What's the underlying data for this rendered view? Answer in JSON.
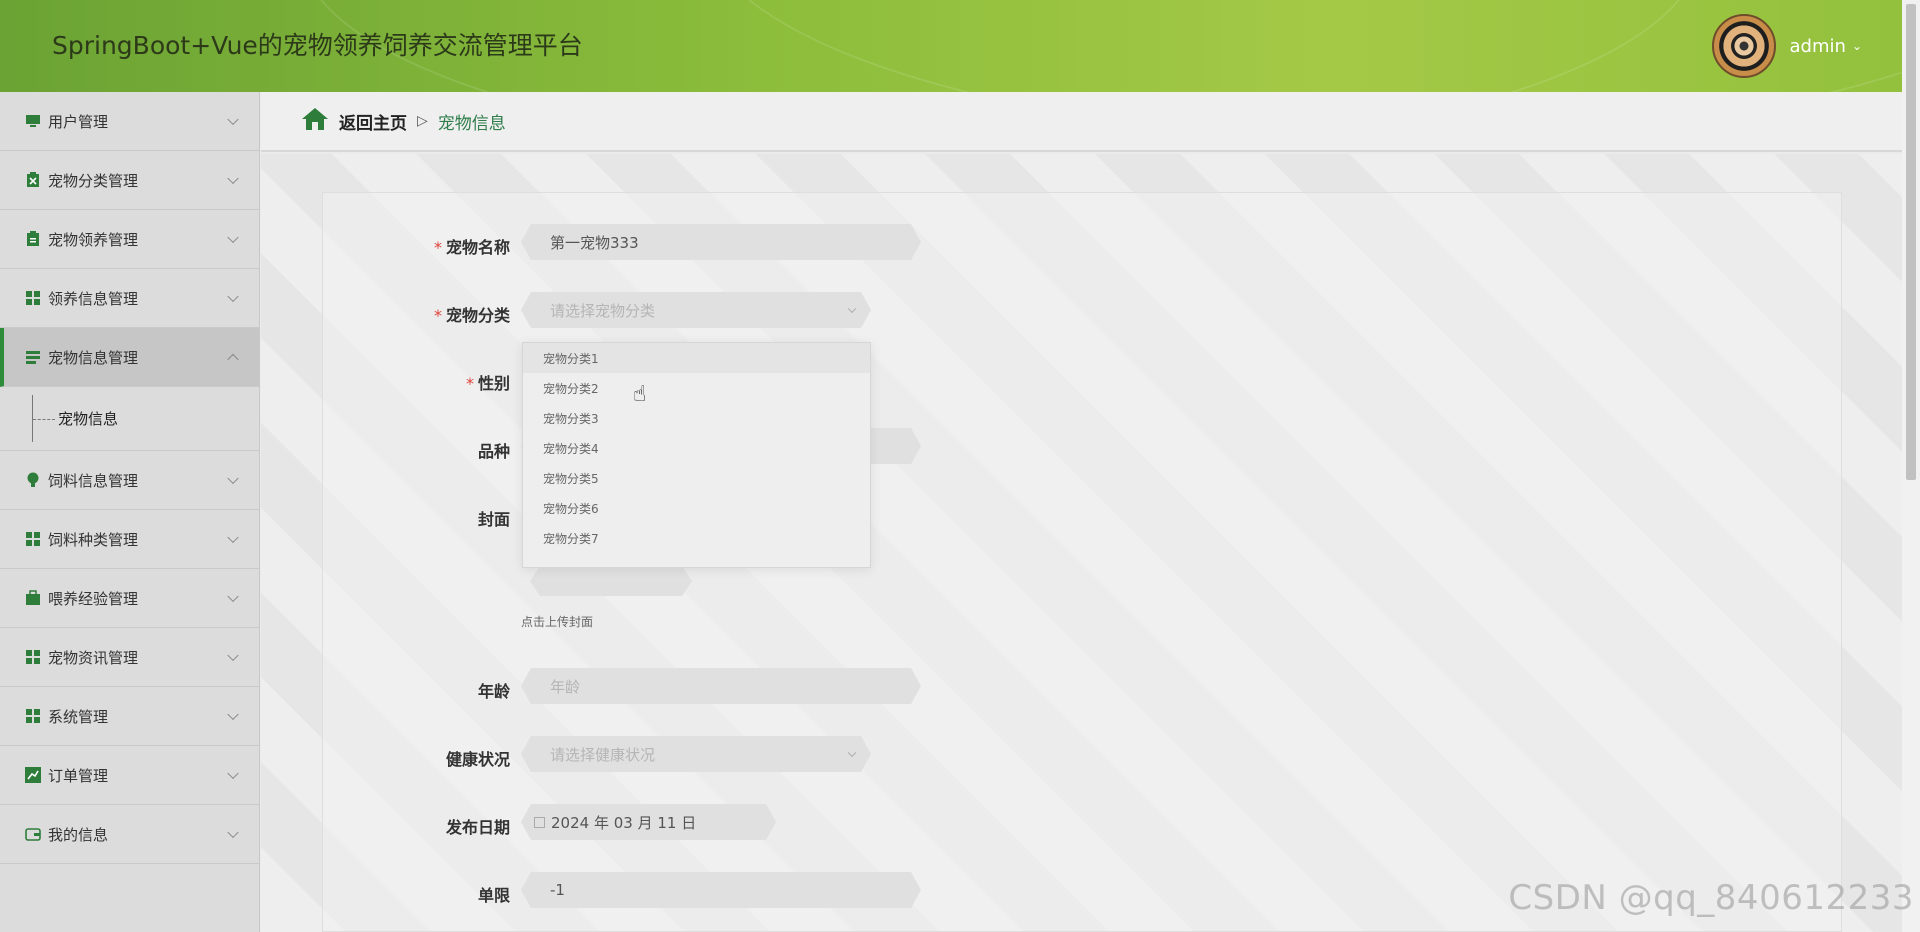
{
  "header": {
    "title": "SpringBoot+Vue的宠物领养饲养交流管理平台",
    "username": "admin",
    "caret": "⌄"
  },
  "sidebar": {
    "items": [
      {
        "label": "用户管理",
        "icon": "monitor-icon"
      },
      {
        "label": "宠物分类管理",
        "icon": "clipboard-x-icon"
      },
      {
        "label": "宠物领养管理",
        "icon": "clipboard-icon"
      },
      {
        "label": "领养信息管理",
        "icon": "grid-icon"
      },
      {
        "label": "宠物信息管理",
        "icon": "list-icon",
        "active": true
      },
      {
        "label": "饲料信息管理",
        "icon": "bulb-icon"
      },
      {
        "label": "饲料种类管理",
        "icon": "grid-icon"
      },
      {
        "label": "喂养经验管理",
        "icon": "briefcase-icon"
      },
      {
        "label": "宠物资讯管理",
        "icon": "grid-icon"
      },
      {
        "label": "系统管理",
        "icon": "grid-icon"
      },
      {
        "label": "订单管理",
        "icon": "chart-icon"
      },
      {
        "label": "我的信息",
        "icon": "wallet-icon"
      }
    ],
    "sub_item": "宠物信息"
  },
  "breadcrumb": {
    "home": "返回主页",
    "separator": "▷",
    "current": "宠物信息"
  },
  "form": {
    "name_label": "宠物名称",
    "name_value": "第一宠物333",
    "category_label": "宠物分类",
    "category_placeholder": "请选择宠物分类",
    "gender_label": "性别",
    "breed_label": "品种",
    "cover_label": "封面",
    "upload_hint": "点击上传封面",
    "age_label": "年龄",
    "age_placeholder": "年龄",
    "health_label": "健康状况",
    "health_placeholder": "请选择健康状况",
    "date_label": "发布日期",
    "date_value": "2024 年 03 月 11 日",
    "limit_label": "单限",
    "limit_value": "-1",
    "required_mark": "*"
  },
  "dropdown": {
    "options": [
      "宠物分类1",
      "宠物分类2",
      "宠物分类3",
      "宠物分类4",
      "宠物分类5",
      "宠物分类6",
      "宠物分类7"
    ]
  },
  "watermark": "CSDN @qq_840612233",
  "colors": {
    "accent": "#2e8b3a",
    "header_green": "#8cbd3b",
    "required": "#e0423a"
  }
}
